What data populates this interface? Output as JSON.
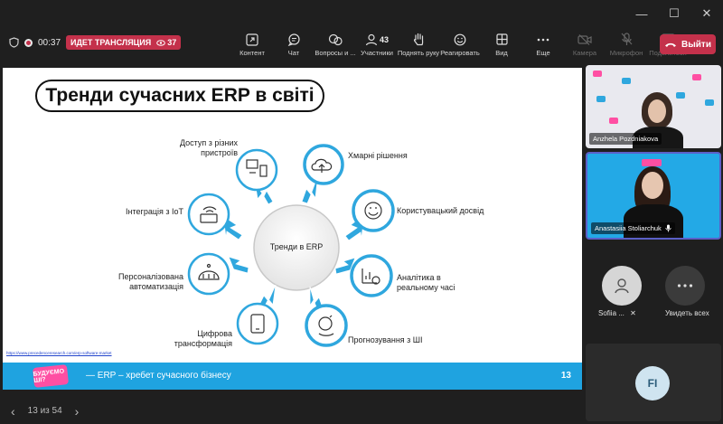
{
  "window": {
    "minimize": "—",
    "maximize": "☐",
    "close": "✕"
  },
  "status": {
    "timer": "00:37",
    "live_label": "ИДЕТ ТРАНСЛЯЦИЯ",
    "viewers": "37"
  },
  "toolbar": {
    "items": [
      {
        "label": "Контент",
        "icon": "share-icon"
      },
      {
        "label": "Чат",
        "icon": "chat-icon"
      },
      {
        "label": "Вопросы и ...",
        "icon": "qna-icon"
      },
      {
        "label": "Участники",
        "icon": "people-icon",
        "badge": "43"
      },
      {
        "label": "Поднять руку",
        "icon": "hand-icon"
      },
      {
        "label": "Реагировать",
        "icon": "smile-icon"
      },
      {
        "label": "Вид",
        "icon": "grid-icon"
      },
      {
        "label": "Еще",
        "icon": "more-icon"
      },
      {
        "label": "Камера",
        "icon": "camera-off-icon"
      },
      {
        "label": "Микрофон",
        "icon": "mic-off-icon"
      },
      {
        "label": "Поделиться",
        "icon": "share-screen-icon"
      }
    ],
    "leave_label": "Выйти"
  },
  "slide": {
    "title": "Тренди сучасних ERP в світі",
    "center": "Тренди в ERP",
    "labels": {
      "devices": "Доступ з різних пристроїв",
      "cloud": "Хмарні рішення",
      "iot": "Інтеграція з IoT",
      "ux": "Користувацький досвід",
      "automation": "Персоналізована автоматизація",
      "analytics": "Аналітика в реальному часі",
      "digital": "Цифрова трансформація",
      "ai": "Прогнозування з ШІ"
    },
    "source": "https://www.precedenceresearch.com/erp-software-market",
    "footer_logo": "БУДУЄМО ШІ?",
    "footer_text": "— ERP – хребет сучасного бізнесу",
    "page_number": "13"
  },
  "pager": {
    "prev": "‹",
    "position": "13 из 54",
    "next": "›"
  },
  "participants": {
    "video1_name": "Anzhela Pozdniakova",
    "video2_name": "Anastasiia Stoliarchuk",
    "tile3_name": "Sofiia ...",
    "tile4_name": "Увидеть всех",
    "fi_initials": "FI"
  },
  "colors": {
    "accent": "#c4314b",
    "slide_blue": "#1fa3e0",
    "icon_blue": "#2fa7de",
    "team_purple": "#5b5fc7"
  }
}
